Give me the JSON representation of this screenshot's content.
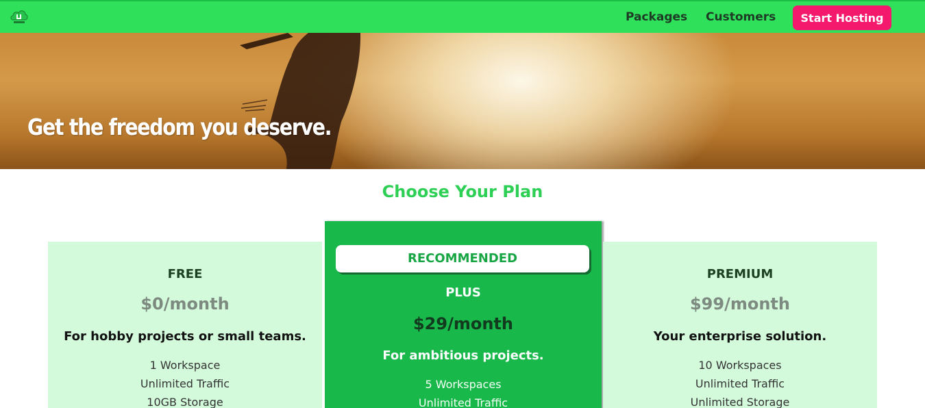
{
  "nav": {
    "links": [
      "Packages",
      "Customers"
    ],
    "cta_label": "Start Hosting",
    "logo_icon": "cloud-logo-icon",
    "colors": {
      "bar": "#2ee05a",
      "cta": "#f4196d"
    }
  },
  "hero": {
    "title": "Get the freedom you deserve."
  },
  "pricing": {
    "heading": "Choose Your Plan",
    "plans": [
      {
        "name": "FREE",
        "price": "$0/month",
        "description": "For hobby projects or small teams.",
        "features": [
          "1 Workspace",
          "Unlimited Traffic",
          "10GB Storage"
        ]
      },
      {
        "badge": "RECOMMENDED",
        "name": "PLUS",
        "price": "$29/month",
        "description": "For ambitious projects.",
        "features": [
          "5 Workspaces",
          "Unlimited Traffic"
        ]
      },
      {
        "name": "PREMIUM",
        "price": "$99/month",
        "description": "Your enterprise solution.",
        "features": [
          "10 Workspaces",
          "Unlimited Traffic",
          "Unlimited Storage"
        ]
      }
    ],
    "colors": {
      "card": "#d4fadc",
      "highlight": "#19b84a",
      "heading": "#2ecf55"
    }
  }
}
